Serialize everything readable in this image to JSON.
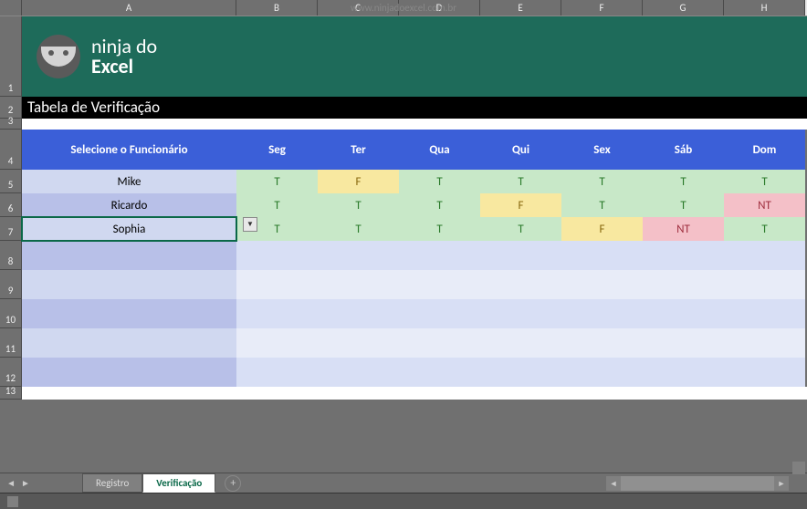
{
  "watermark": "www.ninjadoexcel.com.br",
  "columns": [
    "A",
    "B",
    "C",
    "D",
    "E",
    "F",
    "G",
    "H"
  ],
  "rows": [
    "1",
    "2",
    "3",
    "4",
    "5",
    "6",
    "7",
    "8",
    "9",
    "10",
    "11",
    "12",
    "13"
  ],
  "logo": {
    "line1": "ninja do",
    "line2": "Excel"
  },
  "title": "Tabela de Verificação",
  "table": {
    "headers": [
      "Selecione o Funcionário",
      "Seg",
      "Ter",
      "Qua",
      "Qui",
      "Sex",
      "Sáb",
      "Dom"
    ],
    "rows": [
      {
        "name": "Mike",
        "vals": [
          "T",
          "F",
          "T",
          "T",
          "T",
          "T",
          "T"
        ]
      },
      {
        "name": "Ricardo",
        "vals": [
          "T",
          "T",
          "T",
          "F",
          "T",
          "T",
          "NT"
        ]
      },
      {
        "name": "Sophia",
        "vals": [
          "T",
          "T",
          "T",
          "T",
          "F",
          "NT",
          "T"
        ]
      }
    ],
    "selected_row": 2
  },
  "tabs": {
    "items": [
      "Registro",
      "Verificação"
    ],
    "active": 1
  },
  "nav": {
    "prev": "◄",
    "next": "►",
    "add": "+"
  }
}
